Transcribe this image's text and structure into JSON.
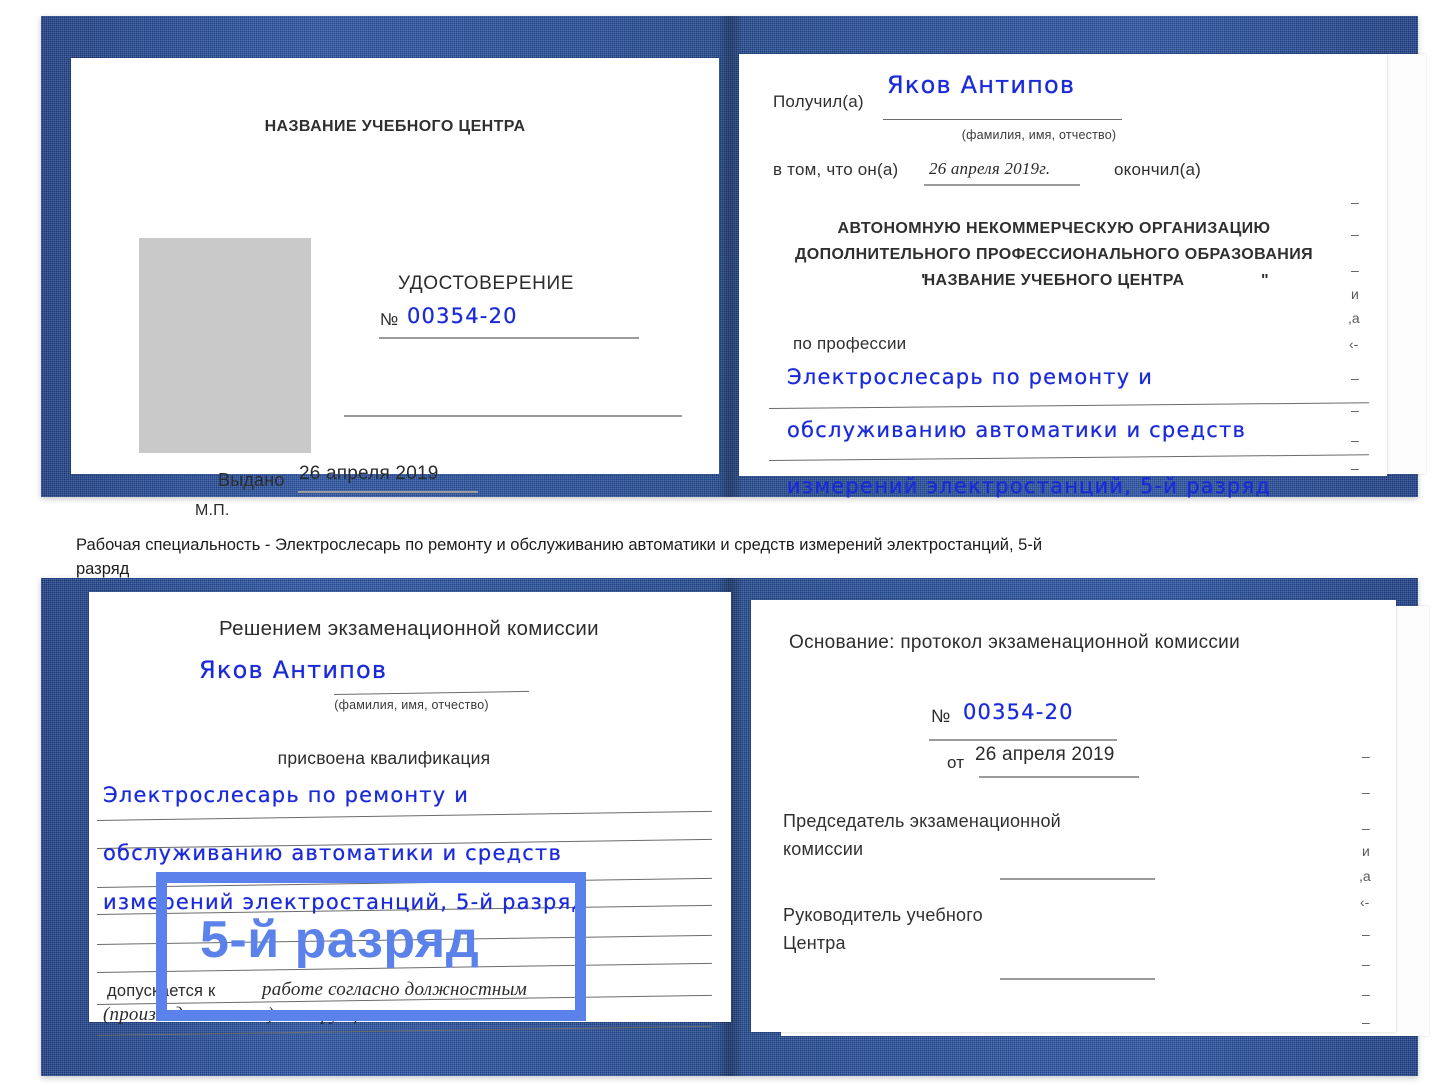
{
  "document": {
    "kind": "udostoverenie-scan",
    "caption": "Рабочая специальность - Электрослесарь по ремонту и обслуживанию автоматики и средств измерений электростанций, 5-й разряд"
  },
  "annotation": {
    "label": "5-й разряд",
    "color": "#5b82ea"
  },
  "colors": {
    "cover_blue": "#22488f",
    "ink_blue": "#1a2ad8",
    "photo_gray": "#c9c9c9",
    "rule_gray": "#9b9b9b"
  },
  "top_certificate": {
    "left_page": {
      "center_name": "НАЗВАНИЕ УЧЕБНОГО ЦЕНТРА",
      "doc_title": "УДОСТОВЕРЕНИЕ",
      "number_label": "№",
      "number_value": "00354-20",
      "issued_label": "Выдано",
      "issued_value": "26 апреля 2019",
      "stamp_label": "М.П."
    },
    "right_page": {
      "received_label": "Получил(а)",
      "received_value": "Яков Антипов",
      "fio_hint": "(фамилия, имя, отчество)",
      "in_that_label": "в том, что он(а)",
      "completion_date": "26 апреля 2019г.",
      "finished_label": "окончил(а)",
      "org_line1": "АВТОНОМНУЮ НЕКОММЕРЧЕСКУЮ ОРГАНИЗАЦИЮ",
      "org_line2": "ДОПОЛНИТЕЛЬНОГО ПРОФЕССИОНАЛЬНОГО ОБРАЗОВАНИЯ",
      "org_quote_open": "\"",
      "org_line3": "НАЗВАНИЕ УЧЕБНОГО ЦЕНТРА",
      "org_quote_close": "\"",
      "profession_label": "по профессии",
      "profession_line1": "Электрослесарь по ремонту и",
      "profession_line2": "обслуживанию автоматики и средств",
      "profession_line3": "измерений электростанций, 5-й разряд",
      "margin_glyphs": [
        "–",
        "–",
        "–",
        "и",
        ",а",
        "‹-",
        "–",
        "–",
        "–",
        "–"
      ]
    }
  },
  "bottom_certificate": {
    "left_page": {
      "heading": "Решением экзаменационной комиссии",
      "name_value": "Яков Антипов",
      "fio_hint": "(фамилия, имя, отчество)",
      "qualification_label": "присвоена квалификация",
      "qualification_line1": "Электрослесарь по ремонту и",
      "qualification_line2": "обслуживанию автоматики и средств",
      "qualification_line3": "измерений электростанций, 5-й разряд",
      "admitted_label": "допускается к",
      "admitted_value_line1": "работе согласно должностным",
      "admitted_value_line2": "(производственным) инструкциям"
    },
    "right_page": {
      "basis_label": "Основание: протокол экзаменационной комиссии",
      "number_label": "№",
      "number_value": "00354-20",
      "from_label": "от",
      "from_value": "26 апреля 2019",
      "chairman_line1": "Председатель экзаменационной",
      "chairman_line2": "комиссии",
      "head_line1": "Руководитель учебного",
      "head_line2": "Центра",
      "margin_glyphs": [
        "–",
        "–",
        "–",
        "и",
        ",а",
        "‹-",
        "–",
        "–",
        "–",
        "–"
      ]
    }
  }
}
